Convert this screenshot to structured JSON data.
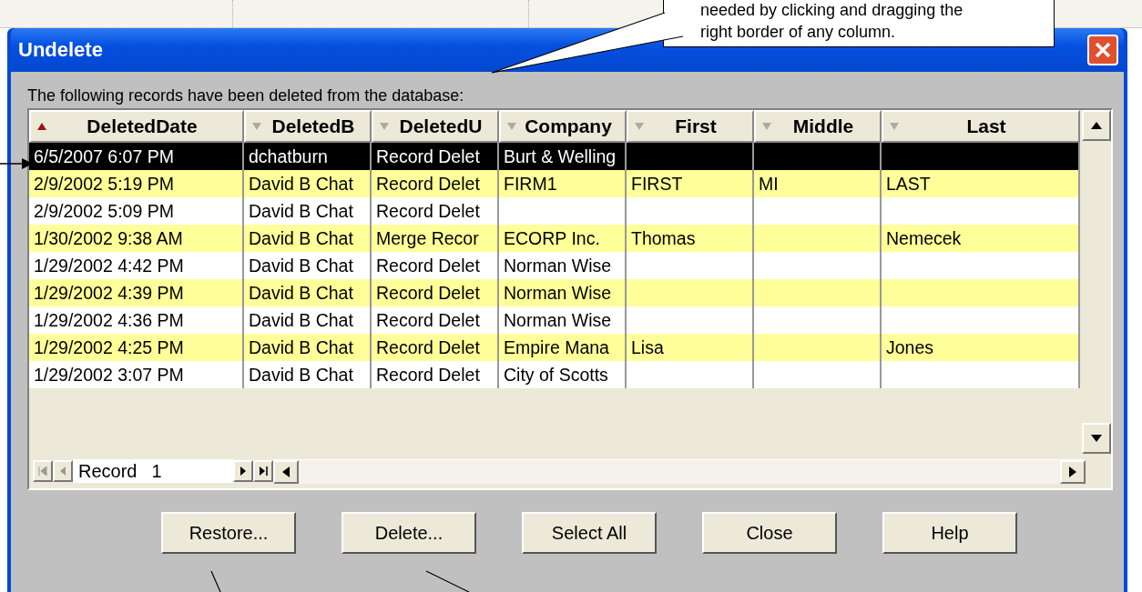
{
  "callout": {
    "lines": [
      "needed by clicking and dragging the",
      "right border of any column."
    ]
  },
  "window": {
    "title": "Undelete"
  },
  "intro": "The following records have been deleted from the database:",
  "table": {
    "columns": [
      {
        "label": "DeletedDate",
        "sorted": true
      },
      {
        "label": "DeletedB",
        "sorted": false
      },
      {
        "label": "DeletedU",
        "sorted": false
      },
      {
        "label": "Company",
        "sorted": false
      },
      {
        "label": "First",
        "sorted": false
      },
      {
        "label": "Middle",
        "sorted": false
      },
      {
        "label": "Last",
        "sorted": false
      }
    ],
    "rows": [
      {
        "selected": true,
        "cells": [
          "6/5/2007 6:07 PM",
          "dchatburn",
          "Record Delet",
          "Burt & Welling",
          "",
          "",
          ""
        ]
      },
      {
        "selected": false,
        "cells": [
          "2/9/2002 5:19 PM",
          "David B Chat",
          "Record Delet",
          "FIRM1",
          "FIRST",
          "MI",
          "LAST"
        ]
      },
      {
        "selected": false,
        "cells": [
          "2/9/2002 5:09 PM",
          "David B Chat",
          "Record Delet",
          "",
          "",
          "",
          ""
        ]
      },
      {
        "selected": false,
        "cells": [
          "1/30/2002 9:38 AM",
          "David B Chat",
          "Merge Recor",
          "ECORP Inc.",
          "Thomas",
          "",
          "Nemecek"
        ]
      },
      {
        "selected": false,
        "cells": [
          "1/29/2002 4:42 PM",
          "David B Chat",
          "Record Delet",
          "Norman Wise",
          "",
          "",
          ""
        ]
      },
      {
        "selected": false,
        "cells": [
          "1/29/2002 4:39 PM",
          "David B Chat",
          "Record Delet",
          "Norman Wise",
          "",
          "",
          ""
        ]
      },
      {
        "selected": false,
        "cells": [
          "1/29/2002 4:36 PM",
          "David B Chat",
          "Record Delet",
          "Norman Wise",
          "",
          "",
          ""
        ]
      },
      {
        "selected": false,
        "cells": [
          "1/29/2002 4:25 PM",
          "David B Chat",
          "Record Delet",
          "Empire Mana",
          "Lisa",
          "",
          "Jones"
        ]
      },
      {
        "selected": false,
        "cells": [
          "1/29/2002 3:07 PM",
          "David B Chat",
          "Record Delet",
          "City of Scotts",
          "",
          "",
          ""
        ]
      }
    ]
  },
  "navigator": {
    "label": "Record",
    "value": "1"
  },
  "buttons": [
    "Restore...",
    "Delete...",
    "Select All",
    "Close",
    "Help"
  ]
}
